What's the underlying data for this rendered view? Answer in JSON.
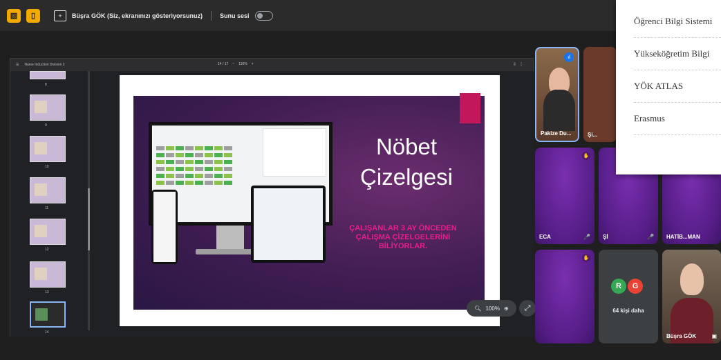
{
  "topbar": {
    "presenter_text": "Büşra GÖK (Siz, ekranınızı gösteriyorsunuz)",
    "audio_label": "Sunu sesi"
  },
  "dropdown": {
    "items": [
      "Öğrenci Bilgi Sistemi",
      "Yükseköğretim Bilgi",
      "YÖK ATLAS",
      "Erasmus"
    ]
  },
  "viewer": {
    "doc_title": "Nurse Induction Division 2",
    "page_info": "14 / 17",
    "zoom_value": "110%",
    "thumb_numbers": [
      "8",
      "9",
      "10",
      "11",
      "12",
      "13",
      "14"
    ]
  },
  "slide": {
    "title_line1": "Nöbet",
    "title_line2": "Çizelgesi",
    "subtitle_line1": "ÇALIŞANLAR 3 AY ÖNCEDEN",
    "subtitle_line2": "ÇALIŞMA ÇİZELGELERİNİ",
    "subtitle_line3": "BİLİYORLAR."
  },
  "zoom_control": {
    "value": "100%"
  },
  "participants": {
    "tile1_name": "Pakize Du...",
    "tile2_name": "Şi...",
    "tile3_name": "ECA",
    "tile4_name": "Şİ",
    "tile5_name": "HATİB...MAN",
    "more_count": "64 kişi daha",
    "avatar_r": "R",
    "avatar_g": "G",
    "self_name": "Büşra GÖK"
  },
  "colors": {
    "accent_pink": "#e91e8c",
    "tile_purple": "#5a1f7a",
    "avatar_r": "#34a853",
    "avatar_g": "#ea4335",
    "highlight_yellow": "#f2a900"
  }
}
